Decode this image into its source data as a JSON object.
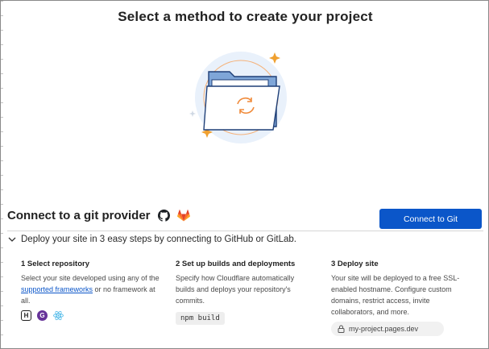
{
  "page": {
    "title": "Select a method to create your project"
  },
  "provider": {
    "title": "Connect to a git provider",
    "github_icon": "github-icon",
    "gitlab_icon": "gitlab-icon",
    "connect_button": "Connect to Git"
  },
  "deploy": {
    "text": "Deploy your site in 3 easy steps by connecting to GitHub or GitLab."
  },
  "steps": [
    {
      "title": "1 Select repository",
      "desc_before": "Select your site developed using any of the ",
      "link": "supported frameworks",
      "desc_after": " or no framework at all."
    },
    {
      "title": "2 Set up builds and deployments",
      "desc": "Specify how Cloudflare automatically builds and deploys your repository's commits.",
      "code": "npm build"
    },
    {
      "title": "3 Deploy site",
      "desc": "Your site will be deployed to a free SSL-enabled hostname. Configure custom domains, restrict access, invite collaborators, and more.",
      "domain": "my-project.pages.dev"
    }
  ],
  "colors": {
    "accent": "#0b56c9",
    "gitlab": "#e24329",
    "sparkle": "#f0a030"
  }
}
